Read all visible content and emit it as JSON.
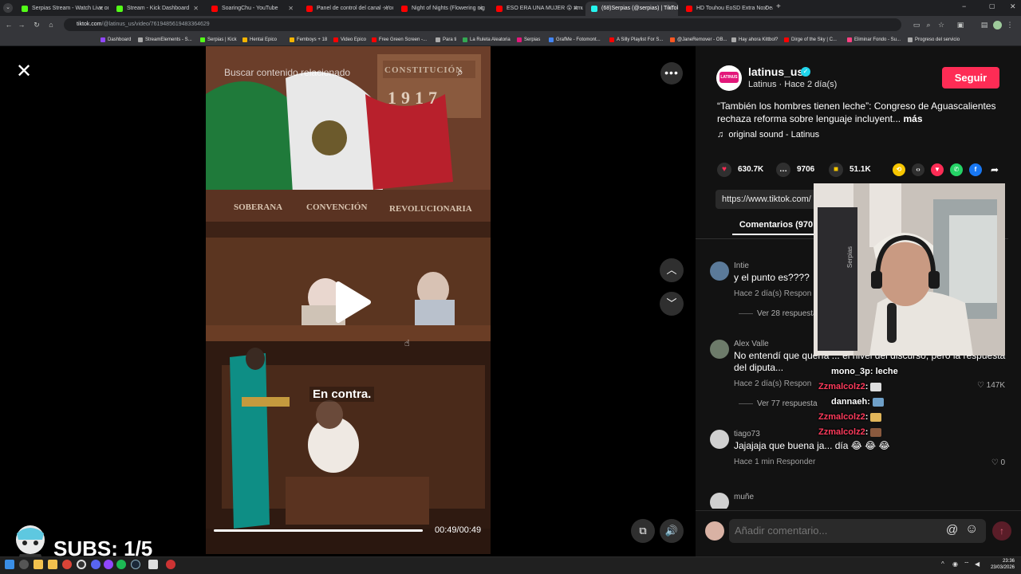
{
  "browser": {
    "tabs": [
      {
        "label": "Serpias Stream - Watch Live on",
        "favicon_color": "#53fc18"
      },
      {
        "label": "Stream - Kick Dashboard",
        "favicon_color": "#53fc18"
      },
      {
        "label": "SoaringChu - YouTube",
        "favicon_color": "#ff0000"
      },
      {
        "label": "Panel de control del canal - You",
        "favicon_color": "#ff0000"
      },
      {
        "label": "Night of Nights (Flowering nig",
        "favicon_color": "#ff0000"
      },
      {
        "label": "ESO ERA UNA MUJER 😮 #mu",
        "favicon_color": "#ff0000"
      },
      {
        "label": "(68)Serpias (@serpias) | TikTok",
        "favicon_color": "#25f4ee"
      },
      {
        "label": "HD Touhou EoSD Extra No Dea",
        "favicon_color": "#ff0000"
      }
    ],
    "url_host": "tiktok.com",
    "url_rest": "/@latinus_us/video/7619485619483364629",
    "bookmarks": [
      {
        "label": "Dashboard",
        "color": "#9147ff"
      },
      {
        "label": "StreamElements - S...",
        "color": "#aaaaaa"
      },
      {
        "label": "Serpias | Kick",
        "color": "#53fc18"
      },
      {
        "label": "Hentai Epico",
        "color": "#f4b400"
      },
      {
        "label": "Femboys + 18",
        "color": "#f4b400"
      },
      {
        "label": "Video Epico",
        "color": "#ff0000"
      },
      {
        "label": "Free Green Screen -...",
        "color": "#ff0000"
      },
      {
        "label": "Para ti",
        "color": "#aaaaaa"
      },
      {
        "label": "La Ruleta Aleatoria",
        "color": "#34a853"
      },
      {
        "label": "Serpias",
        "color": "#e3177a"
      },
      {
        "label": "GrafMe - Fotomont...",
        "color": "#4285f4"
      },
      {
        "label": "A Silly Playlist For S...",
        "color": "#ff0000"
      },
      {
        "label": "@JaneRemover - OB...",
        "color": "#ff5722"
      },
      {
        "label": "Hay ahora Kittbol?",
        "color": "#aaaaaa"
      },
      {
        "label": "Dirge of the Sky | C...",
        "color": "#ff0000"
      },
      {
        "label": "Eliminar Fondo - Su...",
        "color": "#ff4081"
      },
      {
        "label": "Progreso del servicio",
        "color": "#aaaaaa"
      }
    ]
  },
  "video": {
    "search_placeholder": "Buscar contenido relacionado",
    "banner_top": "CONSTITUCIÓN",
    "banner_year": "1917",
    "banner_words": [
      "SOBERANA",
      "CONVENCIÓN",
      "REVOLUCIONARIA"
    ],
    "caption": "En contra.",
    "time": "00:49/00:49",
    "progress": 1.0
  },
  "post": {
    "username": "latinus_us",
    "subline": "Latinus · Hace 2 día(s)",
    "follow_label": "Seguir",
    "avatar_text": "LATINUS",
    "description": "“También los hombres tienen leche”: Congreso de Aguascalientes rechaza reforma sobre lenguaje incluyent...",
    "more_label": "más",
    "sound": "original sound - Latinus",
    "likes": "630.7K",
    "comments": "9706",
    "saves": "51.1K",
    "link": "https://www.tiktok.com/",
    "comments_tab": "Comentarios (970"
  },
  "comments": [
    {
      "user": "Intie",
      "text": "y el punto es????",
      "meta": "Hace 2 día(s)   Respon",
      "likes": "61",
      "replies": "Ver 28 respuesta",
      "avatar_color": "#5b7a99"
    },
    {
      "user": "Alex Valle",
      "text": "No entendí que quería ... el nivel del discurso, pero la respuesta del diputa...",
      "meta": "Hace 2 día(s)   Respon",
      "likes": "147K",
      "replies": "Ver 77 respuesta",
      "avatar_color": "#6d7b6a"
    },
    {
      "user": "tiago73",
      "text": "Jajajaja que buena ja... día 😂 😂 😂",
      "meta": "Hace 1 min   Responder",
      "likes": "0",
      "avatar_color": "#d0d0d0"
    },
    {
      "user": "muñe",
      "text": "",
      "meta": "",
      "likes": "",
      "avatar_color": "#d0d0d0"
    }
  ],
  "comment_input": {
    "placeholder": "Añadir comentario..."
  },
  "stream_chat": [
    {
      "user": "mono_3p",
      "message": ": leche",
      "color": "#ffffff"
    },
    {
      "user": "Zzmalcolz2",
      "message": ":",
      "color": "#ff3b5c"
    },
    {
      "user": "dannaeh",
      "message": ":",
      "color": "#ffffff"
    },
    {
      "user": "Zzmalcolz2",
      "message": ":",
      "color": "#ff3b5c"
    },
    {
      "user": "Zzmalcolz2",
      "message": ":",
      "color": "#ff3b5c"
    }
  ],
  "subs_overlay": {
    "text": "SUBS: 1/5"
  },
  "taskbar": {
    "time": "23:36",
    "date": "23/03/2026"
  }
}
